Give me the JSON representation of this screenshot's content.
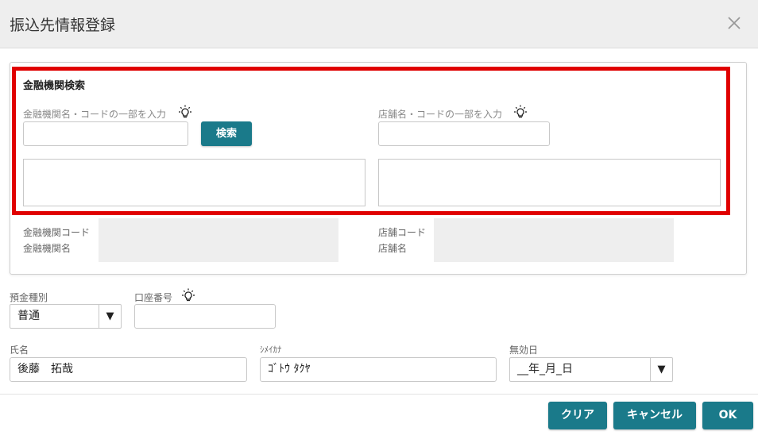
{
  "dialog": {
    "title": "振込先情報登録"
  },
  "bank_search": {
    "section_title": "金融機関検索",
    "bank_label": "金融機関名・コードの一部を入力",
    "bank_value": "",
    "search_button": "検索",
    "branch_label": "店舗名・コードの一部を入力",
    "branch_value": "",
    "bank_code_label": "金融機関コード",
    "bank_name_label": "金融機関名",
    "branch_code_label": "店舗コード",
    "branch_name_label": "店舗名"
  },
  "account": {
    "deposit_type_label": "預金種別",
    "deposit_type_value": "普通",
    "account_number_label": "口座番号",
    "account_number_value": ""
  },
  "person": {
    "name_label": "氏名",
    "name_value": "後藤　拓哉",
    "kana_label": "ｼﾒｲｶﾅ",
    "kana_value": "ｺﾞﾄｳ ﾀｸﾔ",
    "expiry_label": "無効日",
    "expiry_value": "__年_月_日"
  },
  "footer": {
    "clear_button": "クリア",
    "cancel_button": "キャンセル",
    "ok_button": "OK"
  },
  "icons": {
    "close": "close-icon",
    "hint": "lightbulb-icon",
    "dropdown": "triangle-down-icon"
  },
  "colors": {
    "accent": "#1a7a8a",
    "highlight": "#e00000",
    "header_bg": "#eeeeee",
    "readonly_bg": "#eeeeee"
  }
}
